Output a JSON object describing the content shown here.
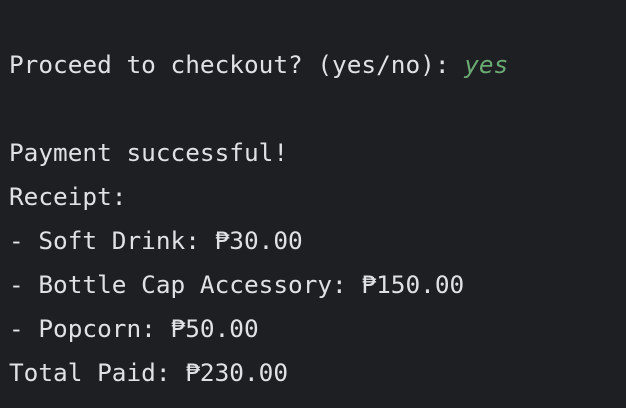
{
  "console": {
    "prompt_text": "Proceed to checkout? (yes/no): ",
    "user_input": "yes",
    "payment_status": "Payment successful!",
    "receipt_header": "Receipt:",
    "receipt_items": [
      "- Soft Drink: ₱30.00",
      "- Bottle Cap Accessory: ₱150.00",
      "- Popcorn: ₱50.00"
    ],
    "total_line": "Total Paid: ₱230.00"
  },
  "colors": {
    "background": "#1e1f22",
    "text": "#dfe1e5",
    "user_input": "#6aab73"
  }
}
